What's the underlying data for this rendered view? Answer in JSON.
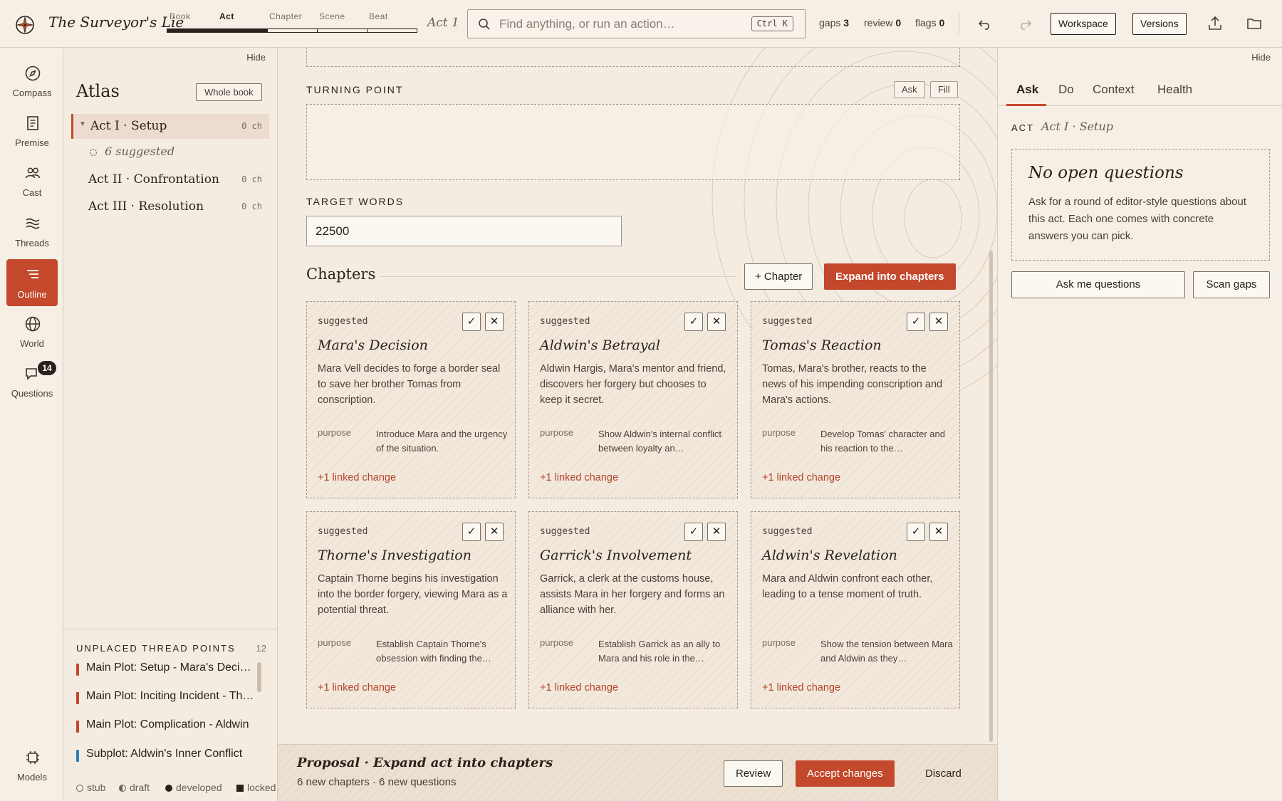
{
  "app": {
    "title": "The Surveyor's Lie"
  },
  "levels": {
    "tabs": [
      {
        "label": "Book"
      },
      {
        "label": "Act",
        "active": true
      },
      {
        "label": "Chapter"
      },
      {
        "label": "Scene"
      },
      {
        "label": "Beat"
      }
    ],
    "crumb": "Act 1"
  },
  "search": {
    "placeholder": "Find anything, or run an action…",
    "shortcut": "Ctrl K"
  },
  "counters": {
    "gaps_label": "gaps",
    "gaps_value": "3",
    "review_label": "review",
    "review_value": "0",
    "flags_label": "flags",
    "flags_value": "0"
  },
  "top_buttons": {
    "workspace": "Workspace",
    "versions": "Versions"
  },
  "rail": {
    "items": [
      {
        "label": "Compass",
        "icon": "compass-icon"
      },
      {
        "label": "Premise",
        "icon": "document-icon"
      },
      {
        "label": "Cast",
        "icon": "people-icon"
      },
      {
        "label": "Threads",
        "icon": "wave-icon"
      },
      {
        "label": "Outline",
        "icon": "outline-icon",
        "active": true
      },
      {
        "label": "World",
        "icon": "globe-icon"
      },
      {
        "label": "Questions",
        "icon": "chat-icon",
        "badge": "14"
      }
    ],
    "bottom": {
      "label": "Models",
      "icon": "chip-icon"
    }
  },
  "atlas": {
    "hide_label": "Hide",
    "title": "Atlas",
    "scope_button": "Whole book",
    "acts": [
      {
        "name": "Act I · Setup",
        "count": "0 ch",
        "active": true,
        "suggested": "6 suggested"
      },
      {
        "name": "Act II · Confrontation",
        "count": "0 ch"
      },
      {
        "name": "Act III · Resolution",
        "count": "0 ch"
      }
    ],
    "unplaced": {
      "title": "UNPLACED THREAD POINTS",
      "count": "12",
      "items": [
        {
          "label": "Main Plot: Setup - Mara's Decision",
          "color": "#c4482b"
        },
        {
          "label": "Main Plot: Inciting Incident - Thorne",
          "color": "#c4482b"
        },
        {
          "label": "Main Plot: Complication - Aldwin",
          "color": "#c4482b"
        },
        {
          "label": "Subplot: Aldwin's Inner Conflict",
          "color": "#2e7fb8"
        }
      ]
    },
    "legend": [
      {
        "label": "stub",
        "mark": "circle-outline"
      },
      {
        "label": "draft",
        "mark": "circle-half"
      },
      {
        "label": "developed",
        "mark": "circle-filled"
      },
      {
        "label": "locked",
        "mark": "square-filled"
      }
    ]
  },
  "main": {
    "turning_point": {
      "label": "TURNING POINT",
      "ask": "Ask",
      "fill": "Fill",
      "value": ""
    },
    "target_words": {
      "label": "TARGET WORDS",
      "value": "22500"
    },
    "chapters": {
      "title": "Chapters",
      "add_button": "+ Chapter",
      "expand_button": "Expand into chapters",
      "purpose_label": "purpose",
      "cards": [
        {
          "status": "suggested",
          "title": "Mara's Decision",
          "description": "Mara Vell decides to forge a border seal to save her brother Tomas from conscription.",
          "purpose": "Introduce Mara and the urgency of the situation.",
          "link": "+1 linked change"
        },
        {
          "status": "suggested",
          "title": "Aldwin's Betrayal",
          "description": "Aldwin Hargis, Mara's mentor and friend, discovers her forgery but chooses to keep it secret.",
          "purpose": "Show Aldwin's internal conflict between loyalty an…",
          "link": "+1 linked change"
        },
        {
          "status": "suggested",
          "title": "Tomas's Reaction",
          "description": "Tomas, Mara's brother, reacts to the news of his impending conscription and Mara's actions.",
          "purpose": "Develop Tomas' character and his reaction to the…",
          "link": "+1 linked change"
        },
        {
          "status": "suggested",
          "title": "Thorne's Investigation",
          "description": "Captain Thorne begins his investigation into the border forgery, viewing Mara as a potential threat.",
          "purpose": "Establish Captain Thorne's obsession with finding the…",
          "link": "+1 linked change"
        },
        {
          "status": "suggested",
          "title": "Garrick's Involvement",
          "description": "Garrick, a clerk at the customs house, assists Mara in her forgery and forms an alliance with her.",
          "purpose": "Establish Garrick as an ally to Mara and his role in the…",
          "link": "+1 linked change"
        },
        {
          "status": "suggested",
          "title": "Aldwin's Revelation",
          "description": "Mara and Aldwin confront each other, leading to a tense moment of truth.",
          "purpose": "Show the tension between Mara and Aldwin as they…",
          "link": "+1 linked change"
        }
      ]
    },
    "proposal": {
      "title": "Proposal · Expand act into chapters",
      "subtitle": "6 new chapters · 6 new questions",
      "review": "Review",
      "accept": "Accept changes",
      "discard": "Discard"
    }
  },
  "right": {
    "hide_label": "Hide",
    "tabs": [
      {
        "label": "Ask",
        "active": true
      },
      {
        "label": "Do"
      },
      {
        "label": "Context"
      },
      {
        "label": "Health"
      }
    ],
    "context": {
      "label": "ACT",
      "value": "Act I · Setup"
    },
    "empty": {
      "title": "No open questions",
      "text": "Ask for a round of editor-style questions about this act. Each one comes with concrete answers you can pick."
    },
    "buttons": {
      "ask": "Ask me questions",
      "scan": "Scan gaps"
    }
  },
  "colors": {
    "accent": "#c4482b",
    "ink": "#2a211b",
    "paper": "#f4ece1",
    "subplot": "#2e7fb8"
  }
}
